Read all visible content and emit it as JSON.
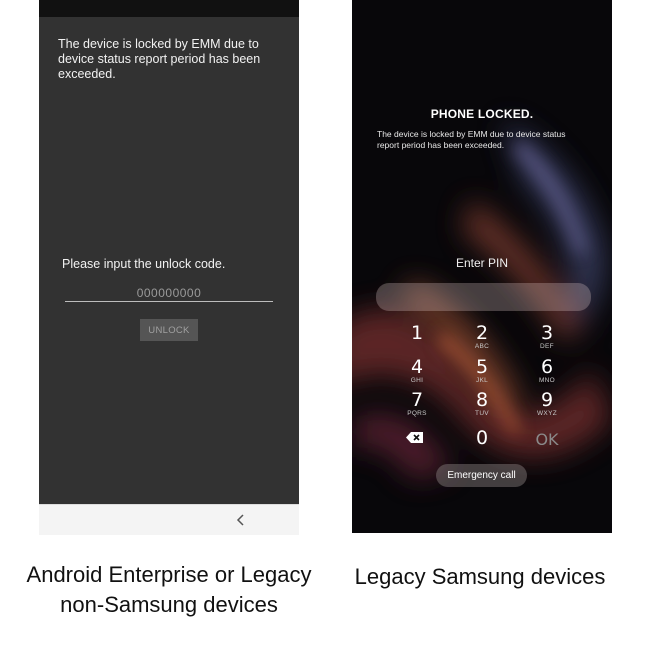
{
  "left_phone": {
    "lock_message": "The device is locked by EMM due to device status report period has been exceeded.",
    "unlock_prompt": "Please input the unlock code.",
    "unlock_code_placeholder": "000000000",
    "unlock_button_label": "UNLOCK",
    "nav_back_icon": "back-chevron-icon"
  },
  "right_phone": {
    "title": "PHONE LOCKED.",
    "lock_message": "The device is locked by EMM due to device status report period has been exceeded.",
    "enter_pin_label": "Enter PIN",
    "keypad": [
      {
        "num": "1",
        "letters": ""
      },
      {
        "num": "2",
        "letters": "ABC"
      },
      {
        "num": "3",
        "letters": "DEF"
      },
      {
        "num": "4",
        "letters": "GHI"
      },
      {
        "num": "5",
        "letters": "JKL"
      },
      {
        "num": "6",
        "letters": "MNO"
      },
      {
        "num": "7",
        "letters": "PQRS"
      },
      {
        "num": "8",
        "letters": "TUV"
      },
      {
        "num": "9",
        "letters": "WXYZ"
      }
    ],
    "zero_key": "0",
    "ok_key": "OK",
    "backspace_icon": "backspace-icon",
    "emergency_call_label": "Emergency call"
  },
  "captions": {
    "left": "Android Enterprise or Legacy non-Samsung devices",
    "right": "Legacy Samsung devices"
  }
}
